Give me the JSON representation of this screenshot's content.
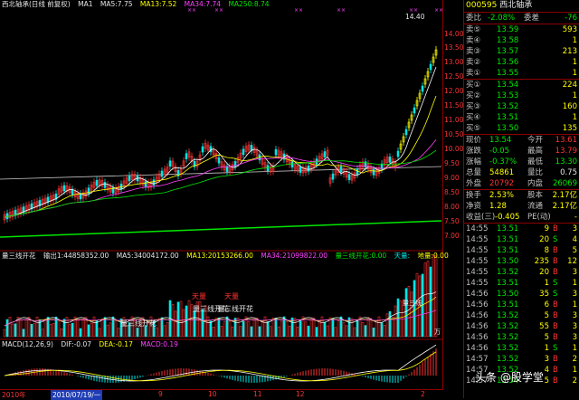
{
  "title_bar": {
    "stock_label": "西北轴承(日线 前复权)",
    "ma1": "MA1",
    "ma5": "MA5:7.75",
    "ma13": "MA13:7.52",
    "ma34": "MA34:7.74",
    "ma250": "MA250:8.74",
    "price_high_label": "14.40"
  },
  "y_axis_ticks": [
    "14.00",
    "13.50",
    "13.00",
    "12.50",
    "12.00",
    "11.50",
    "11.00",
    "10.50",
    "10.00",
    "9.50",
    "9.00",
    "8.50",
    "8.00",
    "7.50",
    "7.00"
  ],
  "volume_bar": {
    "name": "量三线开花",
    "vol": "输出1:44858352.00",
    "ma5": "MA5:34004172.00",
    "ma13": "MA13:20153266.00",
    "ma34": "MA34:21099822.00",
    "extra": "量三线开花:0.00",
    "extra2": "天量:",
    "extra3": "地量:0.00"
  },
  "annotations": [
    "量三线开花",
    "量三线开花",
    "天量",
    "天量",
    "量三线开花",
    "量三线"
  ],
  "volume_unit": "万",
  "macd_bar": {
    "name": "MACD(12,26,9)",
    "dif": "DIF:-0.07",
    "dea": "DEA:-0.17",
    "macd": "MACD:0.19"
  },
  "date_axis": {
    "year": "2010年",
    "date": "2010/07/19/一",
    "ticks": [
      "9",
      "10",
      "11",
      "12",
      "2"
    ]
  },
  "quote": {
    "code": "000595",
    "name": "西北轴承",
    "weibi_label": "委比",
    "weibi_value": "-2.08%",
    "weicha_label": "委差",
    "weicha_value": "-76",
    "asks": [
      {
        "label": "卖⑤",
        "price": "13.59",
        "vol": "593"
      },
      {
        "label": "卖④",
        "price": "13.58",
        "vol": "1"
      },
      {
        "label": "卖③",
        "price": "13.57",
        "vol": "213"
      },
      {
        "label": "卖②",
        "price": "13.56",
        "vol": "1"
      },
      {
        "label": "卖①",
        "price": "13.55",
        "vol": "1"
      }
    ],
    "bids": [
      {
        "label": "买①",
        "price": "13.54",
        "vol": "224"
      },
      {
        "label": "买②",
        "price": "13.53",
        "vol": "1"
      },
      {
        "label": "买③",
        "price": "13.52",
        "vol": "160"
      },
      {
        "label": "买④",
        "price": "13.51",
        "vol": "1"
      },
      {
        "label": "买⑤",
        "price": "13.50",
        "vol": "135"
      }
    ],
    "stats": [
      {
        "l1": "现价",
        "v1": "13.54",
        "l2": "今开",
        "v2": "13.61"
      },
      {
        "l1": "涨跌",
        "v1": "-0.05",
        "l2": "最高",
        "v2": "13.79"
      },
      {
        "l1": "涨幅",
        "v1": "-0.37%",
        "l2": "最低",
        "v2": "13.30"
      },
      {
        "l1": "总量",
        "v1": "54861",
        "l2": "量比",
        "v2": "0.75"
      },
      {
        "l1": "外盘",
        "v1": "20792",
        "l2": "内盘",
        "v2": "26069"
      }
    ],
    "stats2": [
      {
        "l1": "换手",
        "v1": "2.53%",
        "l2": "股本",
        "v2": "2.17亿"
      },
      {
        "l1": "净资",
        "v1": "1.28",
        "l2": "流通",
        "v2": "2.17亿"
      },
      {
        "l1": "收益(三)",
        "v1": "-0.405",
        "l2": "PE(动)",
        "v2": "-"
      }
    ],
    "ticks": [
      {
        "t": "14:55",
        "p": "13.51",
        "v": "9",
        "d": "B",
        "n": "3"
      },
      {
        "t": "14:55",
        "p": "13.51",
        "v": "20",
        "d": "S",
        "n": "4"
      },
      {
        "t": "14:55",
        "p": "13.51",
        "v": "8",
        "d": "B",
        "n": "5"
      },
      {
        "t": "14:55",
        "p": "13.50",
        "v": "235",
        "d": "B",
        "n": "12"
      },
      {
        "t": "14:55",
        "p": "13.52",
        "v": "20",
        "d": "B",
        "n": "3"
      },
      {
        "t": "14:55",
        "p": "13.51",
        "v": "1",
        "d": "S",
        "n": "1"
      },
      {
        "t": "14:56",
        "p": "13.50",
        "v": "35",
        "d": "S",
        "n": "3"
      },
      {
        "t": "14:56",
        "p": "13.51",
        "v": "6",
        "d": "B",
        "n": "1"
      },
      {
        "t": "14:56",
        "p": "13.52",
        "v": "5",
        "d": "B",
        "n": "3"
      },
      {
        "t": "14:56",
        "p": "13.52",
        "v": "55",
        "d": "B",
        "n": "3"
      },
      {
        "t": "14:56",
        "p": "13.52",
        "v": "5",
        "d": "B",
        "n": "3"
      },
      {
        "t": "14:56",
        "p": "13.52",
        "v": "1",
        "d": "S",
        "n": "1"
      },
      {
        "t": "14:57",
        "p": "13.52",
        "v": "3",
        "d": "B",
        "n": "2"
      },
      {
        "t": "14:57",
        "p": "13.52",
        "v": "4",
        "d": "B",
        "n": "1"
      },
      {
        "t": "14:57",
        "p": "13.54",
        "v": "5",
        "d": "B",
        "n": "2"
      }
    ]
  },
  "watermark": "头条 @股学堂",
  "colors": {
    "up": "#ff3232",
    "down": "#00e5e5",
    "ma5": "#ffffff",
    "ma13": "#ffff00",
    "ma34": "#ff40ff",
    "ma250": "#00e600",
    "border": "#8b0000"
  }
}
